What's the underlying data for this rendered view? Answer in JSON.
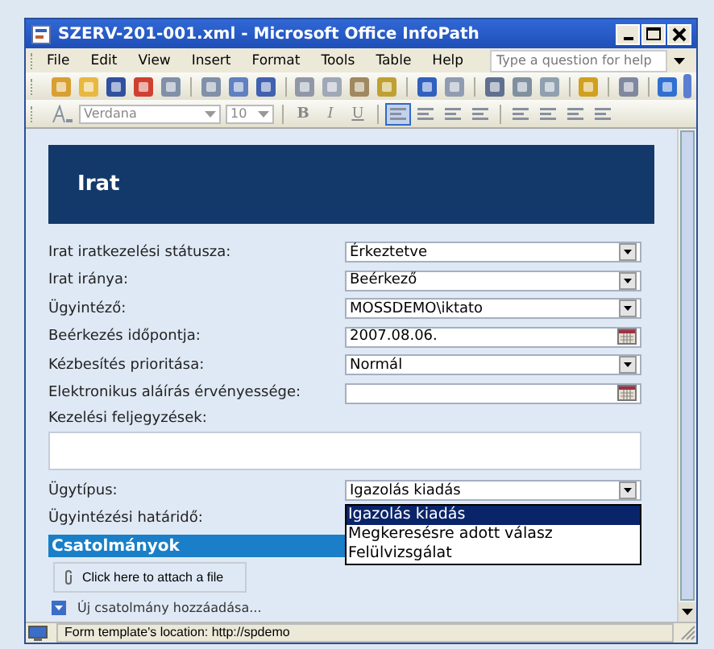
{
  "window": {
    "title": "SZERV-201-001.xml - Microsoft Office InfoPath"
  },
  "menu": [
    {
      "label": "File"
    },
    {
      "label": "Edit"
    },
    {
      "label": "View"
    },
    {
      "label": "Insert"
    },
    {
      "label": "Format"
    },
    {
      "label": "Tools"
    },
    {
      "label": "Table"
    },
    {
      "label": "Help"
    }
  ],
  "help_box": {
    "placeholder": "Type a question for help"
  },
  "format_toolbar": {
    "font": "Verdana",
    "size": "10",
    "style_buttons": [
      "B",
      "I",
      "U"
    ]
  },
  "form": {
    "title": "Irat",
    "fields": [
      {
        "kind": "dropdown",
        "label": "Irat iratkezelési státusza:",
        "value": "Érkeztetve"
      },
      {
        "kind": "dropdown",
        "label": "Irat iránya:",
        "value": "Beérkező"
      },
      {
        "kind": "dropdown",
        "label": "Ügyintéző:",
        "value": "MOSSDEMO\\iktato"
      },
      {
        "kind": "date",
        "label": "Beérkezés időpontja:",
        "value": "2007.08.06."
      },
      {
        "kind": "dropdown",
        "label": "Kézbesítés prioritása:",
        "value": "Normál"
      },
      {
        "kind": "date",
        "label": "Elektronikus aláírás érvényessége:"
      },
      {
        "kind": "notes",
        "label": "Kezelési feljegyzések:"
      },
      {
        "kind": "dropdown",
        "label": "Ügytípus:",
        "value": "Igazolás kiadás",
        "expanded": true,
        "options": [
          {
            "label": "Igazolás kiadás",
            "selected": true
          },
          {
            "label": "Megkeresésre adott válasz",
            "selected": false
          },
          {
            "label": "Felülvizsgálat",
            "selected": false
          }
        ]
      },
      {
        "kind": "label",
        "label": "Ügyintézési határidő:"
      }
    ],
    "attachments": {
      "title": "Csatolmányok",
      "attach": "Click here to attach a file",
      "add_link": "Új csatolmány hozzáadása..."
    }
  },
  "status_bar": "Form template's location: http://spdemo"
}
